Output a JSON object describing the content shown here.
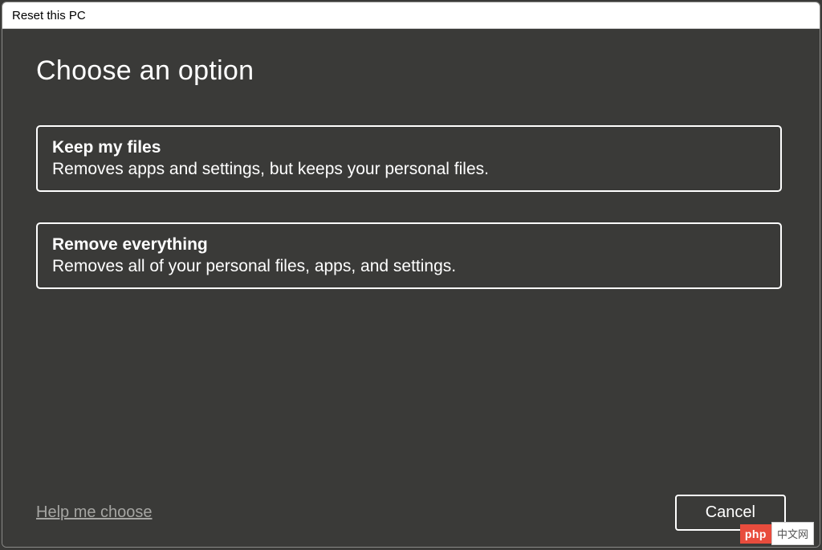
{
  "window": {
    "title": "Reset this PC"
  },
  "main": {
    "heading": "Choose an option",
    "options": [
      {
        "title": "Keep my files",
        "description": "Removes apps and settings, but keeps your personal files."
      },
      {
        "title": "Remove everything",
        "description": "Removes all of your personal files, apps, and settings."
      }
    ]
  },
  "footer": {
    "help_link": "Help me choose",
    "cancel_label": "Cancel"
  },
  "watermark": {
    "left": "php",
    "right": "中文网"
  }
}
